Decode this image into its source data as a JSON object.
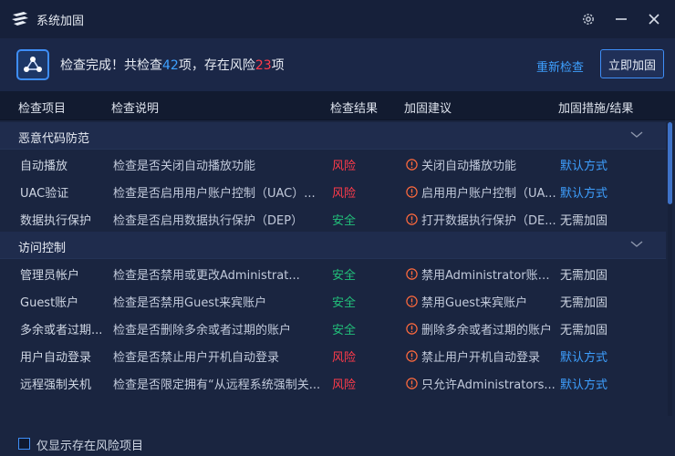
{
  "window": {
    "title": "系统加固",
    "controls": [
      "settings",
      "minimize",
      "close"
    ]
  },
  "summary": {
    "prefix": "检查完成！共检查",
    "checked_count": "42",
    "mid": "项，存在风险",
    "risk_count": "23",
    "suffix": "项",
    "recheck_label": "重新检查",
    "harden_label": "立即加固"
  },
  "table": {
    "headers": {
      "item": "检查项目",
      "desc": "检查说明",
      "result": "检查结果",
      "suggestion": "加固建议",
      "action": "加固措施/结果"
    }
  },
  "groups": [
    {
      "title": "恶意代码防范",
      "rows": [
        {
          "item": "自动播放",
          "desc": "检查是否关闭自动播放功能",
          "result": "风险",
          "result_type": "risk",
          "suggestion": "关闭自动播放功能",
          "action": "默认方式",
          "action_type": "link"
        },
        {
          "item": "UAC验证",
          "desc": "检查是否启用用户账户控制（UAC）...",
          "result": "风险",
          "result_type": "risk",
          "suggestion": "启用用户账户控制（UA...",
          "action": "默认方式",
          "action_type": "link"
        },
        {
          "item": "数据执行保护",
          "desc": "检查是否启用数据执行保护（DEP）",
          "result": "安全",
          "result_type": "safe",
          "suggestion": "打开数据执行保护（DE...",
          "action": "无需加固",
          "action_type": "none"
        }
      ]
    },
    {
      "title": "访问控制",
      "rows": [
        {
          "item": "管理员帐户",
          "desc": "检查是否禁用或更改Administrat...",
          "result": "安全",
          "result_type": "safe",
          "suggestion": "禁用Administrator账户...",
          "action": "无需加固",
          "action_type": "none"
        },
        {
          "item": "Guest账户",
          "desc": "检查是否禁用Guest来宾账户",
          "result": "安全",
          "result_type": "safe",
          "suggestion": "禁用Guest来宾账户",
          "action": "无需加固",
          "action_type": "none"
        },
        {
          "item": "多余或者过期...",
          "desc": "检查是否删除多余或者过期的账户",
          "result": "安全",
          "result_type": "safe",
          "suggestion": "删除多余或者过期的账户",
          "action": "无需加固",
          "action_type": "none"
        },
        {
          "item": "用户自动登录",
          "desc": "检查是否禁止用户开机自动登录",
          "result": "风险",
          "result_type": "risk",
          "suggestion": "禁止用户开机自动登录",
          "action": "默认方式",
          "action_type": "link"
        },
        {
          "item": "远程强制关机",
          "desc": "检查是否限定拥有“从远程系统强制关...",
          "result": "风险",
          "result_type": "risk",
          "suggestion": "只允许Administrators...",
          "action": "默认方式",
          "action_type": "link"
        }
      ]
    }
  ],
  "footer": {
    "checkbox_label": "仅显示存在风险项目",
    "checked": false
  },
  "colors": {
    "accent": "#3ea0ff",
    "risk": "#ff3b4a",
    "safe": "#22c07a",
    "warn": "#ff6a3d"
  }
}
